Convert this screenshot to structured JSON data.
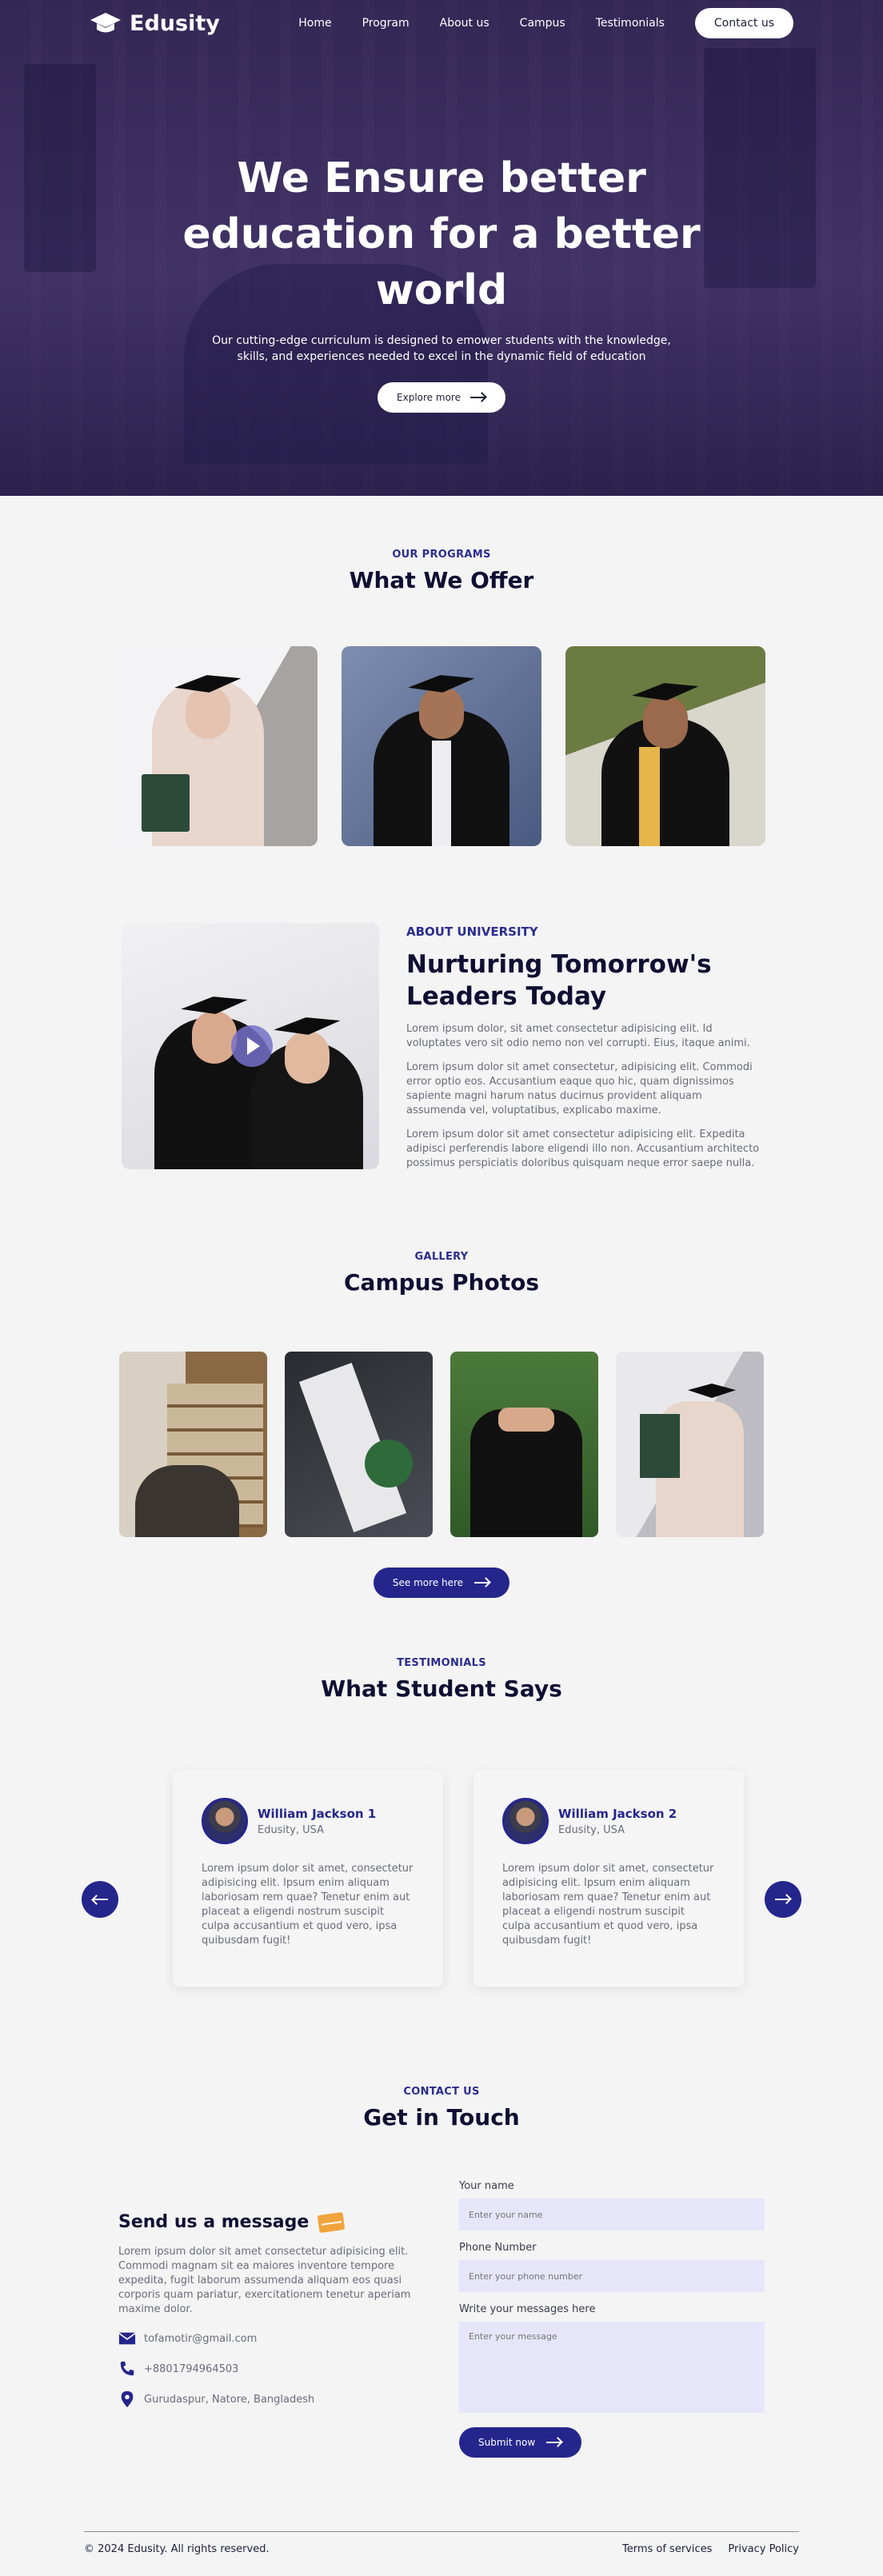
{
  "nav": {
    "brand": "Edusity",
    "links": [
      "Home",
      "Program",
      "About us",
      "Campus",
      "Testimonials"
    ],
    "contact_button": "Contact us"
  },
  "hero": {
    "title": "We Ensure better education for a better world",
    "subtitle": "Our cutting-edge curriculum is designed to emower students with the knowledge, skills, and experiences needed to excel in the dynamic field of education",
    "button": "Explore more"
  },
  "programs": {
    "eyebrow": "OUR PROGRAMS",
    "title": "What We Offer"
  },
  "about": {
    "eyebrow": "ABOUT UNIVERSITY",
    "title": "Nurturing Tomorrow's Leaders Today",
    "paragraphs": [
      "Lorem ipsum dolor, sit amet consectetur adipisicing elit. Id voluptates vero sit odio nemo non vel corrupti. Eius, itaque animi.",
      "Lorem ipsum dolor sit amet consectetur, adipisicing elit. Commodi error optio eos. Accusantium eaque quo hic, quam dignissimos sapiente magni harum natus ducimus provident aliquam assumenda vel, voluptatibus, explicabo maxime.",
      "Lorem ipsum dolor sit amet consectetur adipisicing elit. Expedita adipisci perferendis labore eligendi illo non. Accusantium architecto possimus perspiciatis doloribus quisquam neque error saepe nulla."
    ]
  },
  "gallery": {
    "eyebrow": "GALLERY",
    "title": "Campus Photos",
    "button": "See more here"
  },
  "testimonials": {
    "eyebrow": "TESTIMONIALS",
    "title": "What Student Says",
    "items": [
      {
        "name": "William Jackson 1",
        "location": "Edusity, USA",
        "text": "Lorem ipsum dolor sit amet, consectetur adipisicing elit. Ipsum enim aliquam laboriosam rem quae? Tenetur enim aut placeat a eligendi nostrum suscipit culpa accusantium et quod vero, ipsa quibusdam fugit!"
      },
      {
        "name": "William Jackson 2",
        "location": "Edusity, USA",
        "text": "Lorem ipsum dolor sit amet, consectetur adipisicing elit. Ipsum enim aliquam laboriosam rem quae? Tenetur enim aut placeat a eligendi nostrum suscipit culpa accusantium et quod vero, ipsa quibusdam fugit!"
      }
    ]
  },
  "contact": {
    "eyebrow": "CONTACT US",
    "title": "Get in Touch",
    "left_title": "Send us a message",
    "left_text": "Lorem ipsum dolor sit amet consectetur adipisicing elit. Commodi magnam sit ea maiores inventore tempore expedita, fugit laborum assumenda aliquam eos quasi corporis quam pariatur, exercitationem tenetur aperiam maxime dolor.",
    "email": "tofamotir@gmail.com",
    "phone": "+8801794964503",
    "address": "Gurudaspur, Natore, Bangladesh",
    "form": {
      "name_label": "Your name",
      "name_placeholder": "Enter your name",
      "phone_label": "Phone Number",
      "phone_placeholder": "Enter your phone number",
      "message_label": "Write your messages here",
      "message_placeholder": "Enter your message",
      "submit": "Submit now"
    }
  },
  "footer": {
    "copyright": "© 2024 Edusity. All rights reserved.",
    "links": [
      "Terms of services",
      "Privacy Policy"
    ]
  }
}
